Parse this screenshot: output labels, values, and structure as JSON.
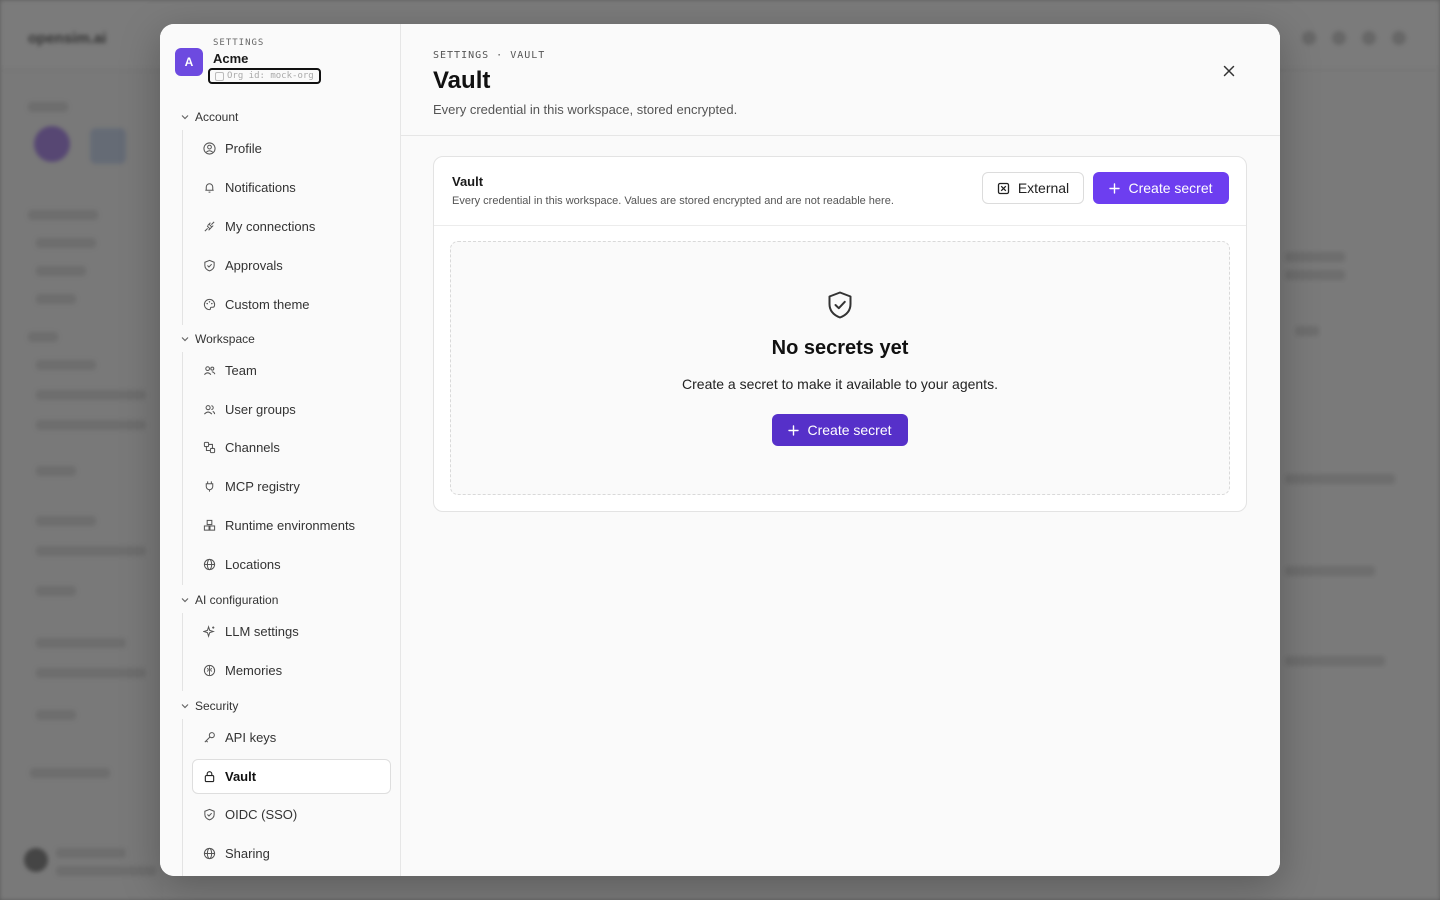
{
  "background": {
    "app_name": "opensim.ai"
  },
  "settings_sidebar": {
    "eyebrow": "SETTINGS",
    "org_avatar_letter": "A",
    "org_name": "Acme",
    "org_id": "Org id: mock-org",
    "sections": [
      {
        "label": "Account",
        "items": [
          {
            "label": "Profile",
            "icon": "user-circle-icon"
          },
          {
            "label": "Notifications",
            "icon": "bell-icon"
          },
          {
            "label": "My connections",
            "icon": "plug-icon"
          },
          {
            "label": "Approvals",
            "icon": "shield-check-icon"
          },
          {
            "label": "Custom theme",
            "icon": "palette-icon"
          }
        ]
      },
      {
        "label": "Workspace",
        "items": [
          {
            "label": "Team",
            "icon": "users-icon"
          },
          {
            "label": "User groups",
            "icon": "user-group-icon"
          },
          {
            "label": "Channels",
            "icon": "channels-icon"
          },
          {
            "label": "MCP registry",
            "icon": "plug-icon"
          },
          {
            "label": "Runtime environments",
            "icon": "boxes-icon"
          },
          {
            "label": "Locations",
            "icon": "globe-icon"
          }
        ]
      },
      {
        "label": "AI configuration",
        "items": [
          {
            "label": "LLM settings",
            "icon": "sparkles-icon"
          },
          {
            "label": "Memories",
            "icon": "brain-icon"
          }
        ]
      },
      {
        "label": "Security",
        "items": [
          {
            "label": "API keys",
            "icon": "key-icon"
          },
          {
            "label": "Vault",
            "icon": "lock-icon",
            "active": true
          },
          {
            "label": "OIDC (SSO)",
            "icon": "shield-check-icon"
          },
          {
            "label": "Sharing",
            "icon": "globe-icon"
          }
        ]
      }
    ]
  },
  "header": {
    "eyebrow": "SETTINGS · VAULT",
    "title": "Vault",
    "subtitle": "Every credential in this workspace, stored encrypted."
  },
  "vault_card": {
    "title": "Vault",
    "description": "Every credential in this workspace. Values are stored encrypted and are not readable here.",
    "external_label": "External",
    "create_label": "Create secret",
    "empty_title": "No secrets yet",
    "empty_text": "Create a secret to make it available to your agents.",
    "empty_create_label": "Create secret"
  },
  "colors": {
    "accent": "#6d3ef0",
    "accent_dark": "#5630c9"
  }
}
